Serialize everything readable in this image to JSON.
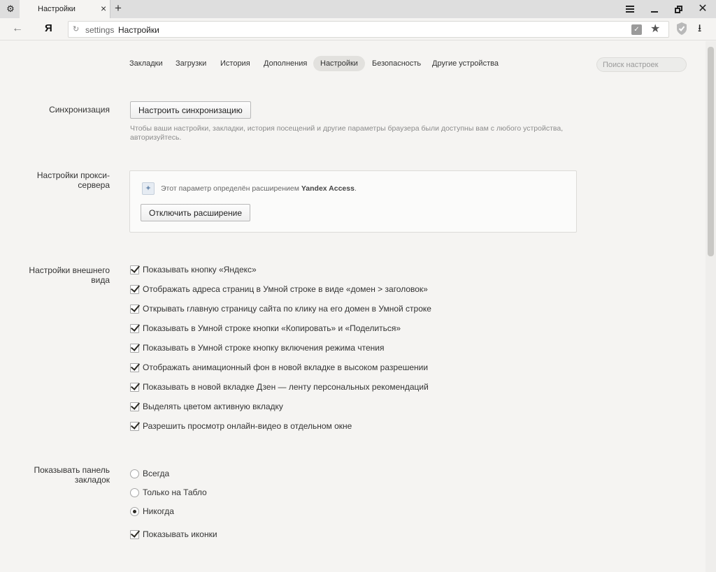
{
  "tab": {
    "title": "Настройки"
  },
  "address": {
    "prefix": "settings",
    "title": "Настройки"
  },
  "nav": {
    "items": [
      "Закладки",
      "Загрузки",
      "История",
      "Дополнения",
      "Настройки",
      "Безопасность",
      "Другие устройства"
    ],
    "active": 4
  },
  "search": {
    "placeholder": "Поиск настроек"
  },
  "sync": {
    "label": "Синхронизация",
    "button": "Настроить синхронизацию",
    "desc": "Чтобы ваши настройки, закладки, история посещений и другие параметры браузера были доступны вам с любого устройства, авторизуйтесь."
  },
  "proxy": {
    "label_line1": "Настройки прокси-",
    "label_line2": "сервера",
    "text_prefix": "Этот параметр определён расширением",
    "ext_name": "Yandex Access",
    "text_suffix": ".",
    "button": "Отключить расширение"
  },
  "appearance": {
    "label_line1": "Настройки внешнего",
    "label_line2": "вида",
    "options": [
      "Показывать кнопку «Яндекс»",
      "Отображать адреса страниц в Умной строке в виде «домен > заголовок»",
      "Открывать главную страницу сайта по клику на его домен в Умной строке",
      "Показывать в Умной строке кнопки «Копировать» и «Поделиться»",
      "Показывать в Умной строке кнопку включения режима чтения",
      "Отображать анимационный фон в новой вкладке в высоком разрешении",
      "Показывать в новой вкладке Дзен — ленту персональных рекомендаций",
      "Выделять цветом активную вкладку",
      "Разрешить просмотр онлайн-видео в отдельном окне"
    ]
  },
  "bookmarks_bar": {
    "label_line1": "Показывать панель",
    "label_line2": "закладок",
    "radios": [
      "Всегда",
      "Только на Табло",
      "Никогда"
    ],
    "selected": 2,
    "show_icons": "Показывать иконки"
  }
}
